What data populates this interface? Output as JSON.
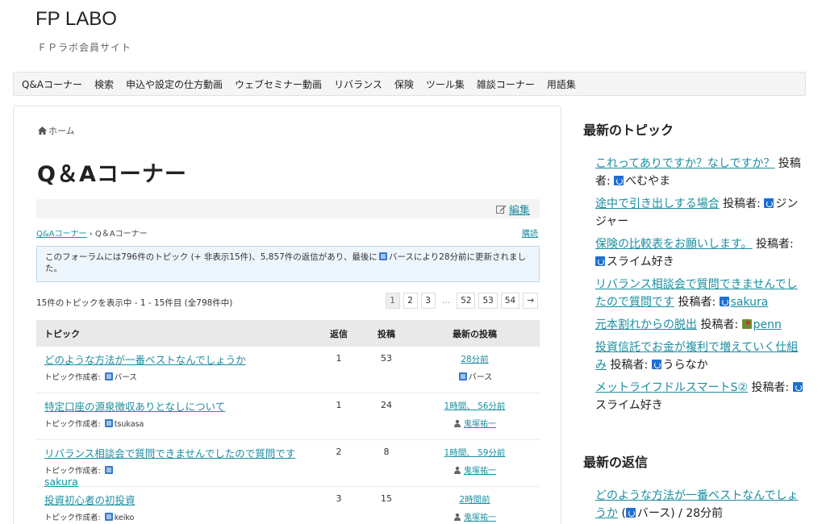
{
  "site": {
    "title": "FP LABO",
    "description": "ＦＰラボ会員サイト"
  },
  "nav": [
    "Q&Aコーナー",
    "検索",
    "申込や設定の仕方動画",
    "ウェブセミナー動画",
    "リバランス",
    "保険",
    "ツール集",
    "雑談コーナー",
    "用語集"
  ],
  "breadcrumb": {
    "home": "ホーム"
  },
  "page": {
    "title": "Q＆Aコーナー",
    "edit_label": "編集"
  },
  "forum_crumbs": {
    "parent": "Q&Aコーナー",
    "separator": "›",
    "current": "Q＆Aコーナー",
    "subscribe": "購読"
  },
  "notice": {
    "before": "このフォーラムには796件のトピック (+ 非表示15件)、5,857件の返信があり、最後に",
    "user": "バース",
    "after": "により28分前に更新されました。"
  },
  "counter": "15件のトピックを表示中 - 1 - 15件目 (全798件中)",
  "pagination": [
    "1",
    "2",
    "3",
    "…",
    "52",
    "53",
    "54",
    "→"
  ],
  "table": {
    "headers": {
      "topic": "トピック",
      "replies": "返信",
      "posts": "投稿",
      "latest": "最新の投稿"
    },
    "author_prefix": "トピック作成者:",
    "rows": [
      {
        "title": "どのような方法が一番ベストなんでしょうか",
        "author": "バース",
        "author_link": false,
        "replies": "1",
        "posts": "53",
        "time": "28分前",
        "last_by": "バース",
        "last_link": false,
        "last_icon": "avatar"
      },
      {
        "title": "特定口座の源泉徴収ありとなしについて",
        "author": "tsukasa",
        "author_link": false,
        "replies": "1",
        "posts": "24",
        "time": "1時間、 56分前",
        "last_by": "鬼塚祐一",
        "last_link": true,
        "last_icon": "person"
      },
      {
        "title": "リバランス相談会で質問できませんでしたので質問です",
        "author": "sakura",
        "author_link": true,
        "replies": "2",
        "posts": "8",
        "time": "1時間、 59分前",
        "last_by": "鬼塚祐一",
        "last_link": true,
        "last_icon": "person"
      },
      {
        "title": "投資初心者の初投資",
        "author": "keiko",
        "author_link": false,
        "replies": "3",
        "posts": "15",
        "time": "2時間前",
        "last_by": "鬼塚祐一",
        "last_link": true,
        "last_icon": "person"
      }
    ]
  },
  "sidebar": {
    "recent_topics_heading": "最新のトピック",
    "by_label": "投稿者:",
    "recent_topics": [
      {
        "title": "これってありですか？なしですか？",
        "author": "べむやま",
        "author_link": false,
        "green": false
      },
      {
        "title": "途中で引き出しする場合",
        "author": "ジンジャー",
        "author_link": false,
        "green": false
      },
      {
        "title": "保険の比較表をお願いします。",
        "author": "スライム好き",
        "author_link": false,
        "green": false
      },
      {
        "title": "リバランス相談会で質問できませんでしたので質問です",
        "author": "sakura",
        "author_link": true,
        "green": false
      },
      {
        "title": "元本割れからの脱出",
        "author": "penn",
        "author_link": true,
        "green": true
      },
      {
        "title": "投資信託でお金が複利で増えていく仕組み",
        "author": "うらなか",
        "author_link": false,
        "green": false
      },
      {
        "title": "メットライフドルスマートS②",
        "author": "スライム好き",
        "author_link": false,
        "green": false
      }
    ],
    "recent_replies_heading": "最新の返信",
    "recent_replies": [
      {
        "title": "どのような方法が一番ベストなんでしょうか",
        "author": "バース",
        "time": "28分前"
      }
    ]
  },
  "colors": {
    "link": "#1a8ea0",
    "avatar": "#1e6fd0"
  }
}
